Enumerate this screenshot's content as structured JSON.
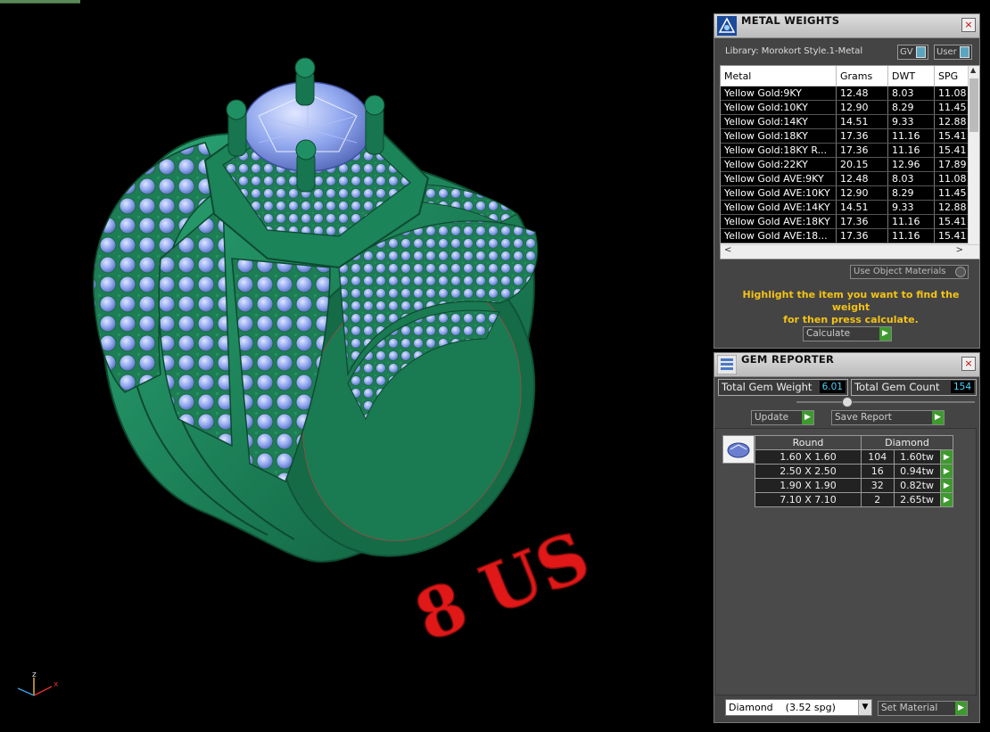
{
  "viewport": {
    "ring_label": "8 US",
    "axes": {
      "x": "x",
      "y": "y",
      "z": "z"
    }
  },
  "metal_weights": {
    "title": "METAL WEIGHTS",
    "close": "×",
    "library_label": "Library: Morokort Style.1-Metal",
    "toggle_gv": "GV",
    "toggle_user": "User",
    "columns": [
      "Metal",
      "Grams",
      "DWT",
      "SPG"
    ],
    "rows": [
      [
        "Yellow Gold:9KY",
        "12.48",
        "8.03",
        "11.08"
      ],
      [
        "Yellow Gold:10KY",
        "12.90",
        "8.29",
        "11.45"
      ],
      [
        "Yellow Gold:14KY",
        "14.51",
        "9.33",
        "12.88"
      ],
      [
        "Yellow Gold:18KY",
        "17.36",
        "11.16",
        "15.41"
      ],
      [
        "Yellow Gold:18KY R...",
        "17.36",
        "11.16",
        "15.41"
      ],
      [
        "Yellow Gold:22KY",
        "20.15",
        "12.96",
        "17.89"
      ],
      [
        "Yellow Gold AVE:9KY",
        "12.48",
        "8.03",
        "11.08"
      ],
      [
        "Yellow Gold AVE:10KY",
        "12.90",
        "8.29",
        "11.45"
      ],
      [
        "Yellow Gold AVE:14KY",
        "14.51",
        "9.33",
        "12.88"
      ],
      [
        "Yellow Gold AVE:18KY",
        "17.36",
        "11.16",
        "15.41"
      ],
      [
        "Yellow Gold AVE:18...",
        "17.36",
        "11.16",
        "15.41"
      ]
    ],
    "use_object_materials": "Use Object Materials",
    "hint_line1": "Highlight the item you want to find the weight",
    "hint_line2": "for then press calculate.",
    "calculate": "Calculate"
  },
  "gem_reporter": {
    "title": "GEM REPORTER",
    "close": "×",
    "total_weight_label": "Total Gem Weight",
    "total_weight_value": "6.01",
    "total_count_label": "Total Gem Count",
    "total_count_value": "154",
    "update": "Update",
    "save_report": "Save Report",
    "columns": {
      "shape": "Round",
      "stone": "Diamond"
    },
    "rows": [
      [
        "1.60 X 1.60",
        "104",
        "1.60tw"
      ],
      [
        "2.50 X 2.50",
        "16",
        "0.94tw"
      ],
      [
        "1.90 X 1.90",
        "32",
        "0.82tw"
      ],
      [
        "7.10 X 7.10",
        "2",
        "2.65tw"
      ]
    ],
    "material_select": "Diamond    (3.52 spg)",
    "set_material": "Set Material"
  },
  "icons": {
    "go": "▶",
    "dropdown": "▼",
    "scroll_up": "▲",
    "scroll_left": "<",
    "scroll_right": ">"
  },
  "colors": {
    "ring_metal": "#1f8a5e",
    "gem": "#8fa6ee",
    "label_red": "#e01818",
    "hint_yellow": "#f4c316",
    "value_cyan": "#4fd2ff",
    "go_green": "#3e9a2e"
  }
}
